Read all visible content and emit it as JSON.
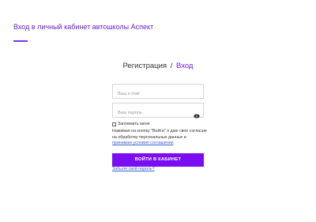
{
  "header": {
    "title": "Вход в личный кабинет автошколы Аспект"
  },
  "tabs": {
    "register": "Регистрация",
    "separator": "/",
    "login": "Вход"
  },
  "form": {
    "email_placeholder": "Ваш e-mail",
    "password_placeholder": "Ваш пароль",
    "show_password_icon": "eye-icon",
    "remember_label": "Запомнить меня",
    "remember_checked": false,
    "consent_text": "Нажимая на кнопку \"Войти\" я даю свое согласие на обработку персональных данных и",
    "consent_link": "принимаю условия соглашения",
    "submit_label": "ВОЙТИ В КАБИНЕТ",
    "forgot_link": "Забыли свой пароль?"
  },
  "colors": {
    "accent": "#7a0df2",
    "title": "#6a1ec8",
    "link": "#3b63c8"
  }
}
